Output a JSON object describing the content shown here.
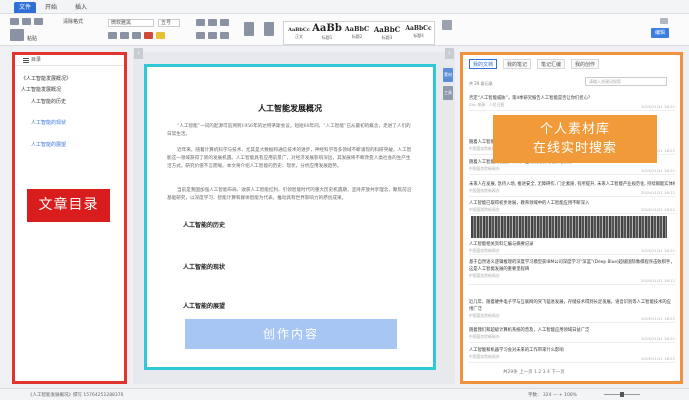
{
  "tabs": [
    {
      "label": "文件"
    },
    {
      "label": "开始"
    },
    {
      "label": "插入"
    }
  ],
  "ribbon": {
    "font_name": "微软雅黑",
    "font_size": "五号",
    "clear_format": "清除格式",
    "paste": "粘贴",
    "styles": [
      {
        "preview": "AaBbCc",
        "name": "正文"
      },
      {
        "preview": "AaBb",
        "name": "标题1"
      },
      {
        "preview": "AaBbC",
        "name": "标题2"
      },
      {
        "preview": "AaBbC",
        "name": "标题3"
      },
      {
        "preview": "AaBbCc",
        "name": "标题4"
      }
    ],
    "blue_button": "编辑"
  },
  "outline": {
    "header": "目录",
    "items": [
      {
        "label": "《人工智能发展概况》"
      },
      {
        "label": "人工智能发展概况"
      },
      {
        "label": "人工智能的历史"
      },
      {
        "label": "人工智能的现状"
      },
      {
        "label": "人工智能的展望"
      }
    ],
    "overlay_label": "文章目录"
  },
  "document": {
    "title": "人工智能发展概况",
    "paragraphs": [
      "“人工智能”一词的起源可追溯到1956年的达特茅斯会议。短短60年间，“人工智能”已从最初的概念，走进了人们的日常生活。",
      "近年来，随着计算机科学与技术、尤其是大数据和通信技术的进步，神经科学等多领域不断涌现的科研突破，人工智能这一领域获得了新的发展机遇。人工智能具有应用前景广，对经济发展影响深远，其发展将不断改变人类社会的生产生活方式，研究价值不言而喻。本文将介绍人工智能的历史、现状，分析应用发展趋势。",
      "当前是我国加强人工智能布局、收获人工智能红利、引领智能时代的重大历史机遇期，坚持开放共享理念，聚焦前沿基础研究，以深度学习、智能计算和群体智能为代表，推动具有世界影响力的原创成果。"
    ],
    "headings": [
      "人工智能的历史",
      "人工智能的现状",
      "人工智能的展望"
    ],
    "create_label": "创作内容"
  },
  "side_tools": [
    "素材",
    "工具"
  ],
  "material": {
    "tabs": [
      {
        "label": "我的文档"
      },
      {
        "label": "我的笔记"
      },
      {
        "label": "笔记汇编"
      },
      {
        "label": "我的创作"
      }
    ],
    "search_placeholder": "请输入关键词搜索",
    "count": "共 29 条记录",
    "overlay_line1": "个人素材库",
    "overlay_line2": "在线实时搜索",
    "rows": [
      {
        "text": "否定“人工智能威胁”，第4季研究报告人工智能是否让你们担心？",
        "meta": "Zhy 来源：人民日报",
        "date": "2019/11/21 16:21"
      },
      {
        "text": "随着人工智能的发展与应用，越来越多的人工智能技术正在走向实用",
        "meta": "中国国务院新闻办",
        "date": "2019/11/21 16:21"
      },
      {
        "text": "随着人工智能的发展，未来产业将成为新的经济增长点",
        "meta": "中国国务院新闻办",
        "date": "2019/11/21 16:21"
      },
      {
        "text": "未来人在发展, 急待入场, 推进安全, 无障碍作, 门企素质, 有所提升, 未来人工智能产业规范化, 持续赋能实体经济",
        "meta": "中国国务院新闻办",
        "date": "2019/11/21 16:21"
      },
      {
        "text": "人工智能已取得初步进展，教育领域中的人工智能应用不断深入",
        "meta": "中国国务院新闻办",
        "date": "2019/11/21 16:21"
      },
      {
        "text": "人工智能相关资料汇编与摘要记录",
        "meta": "中国国务院新闻办",
        "date": "2019/11/21 16:21"
      },
      {
        "text": "基于自然语义逻辑推理的深度学习模型获IBM公司深度学习“深蓝”(Deep Blue)超级国际象棋程序击败棋手，这是人工智能发展的重要里程碑",
        "meta": "中国国务院新闻办",
        "date": "2019/11/21 16:21"
      },
      {
        "text": "近几年，随着硬件电子学与互联网的突飞猛进发展，存储技术得到长足发展，语音识别等人工智能技术的应用广泛",
        "meta": "中国国务院新闻办",
        "date": "2019/11/21 16:21"
      },
      {
        "text": "随着我们和超级计算机系统的普及，人工智能应用领域日益广泛",
        "meta": "中国国务院新闻办",
        "date": "2019/11/21 16:21"
      },
      {
        "text": "人工智能和机器学习会对未来的工作带来什么影响",
        "meta": "中国国务院新闻办",
        "date": "2019/11/21 16:21"
      }
    ],
    "footer": "共29条   上一页   1   2   3   4   下一页"
  },
  "status": {
    "left": "《人工智能发展概况》撰写  15764251288376",
    "right": "字数：  324     —    +    100%"
  }
}
